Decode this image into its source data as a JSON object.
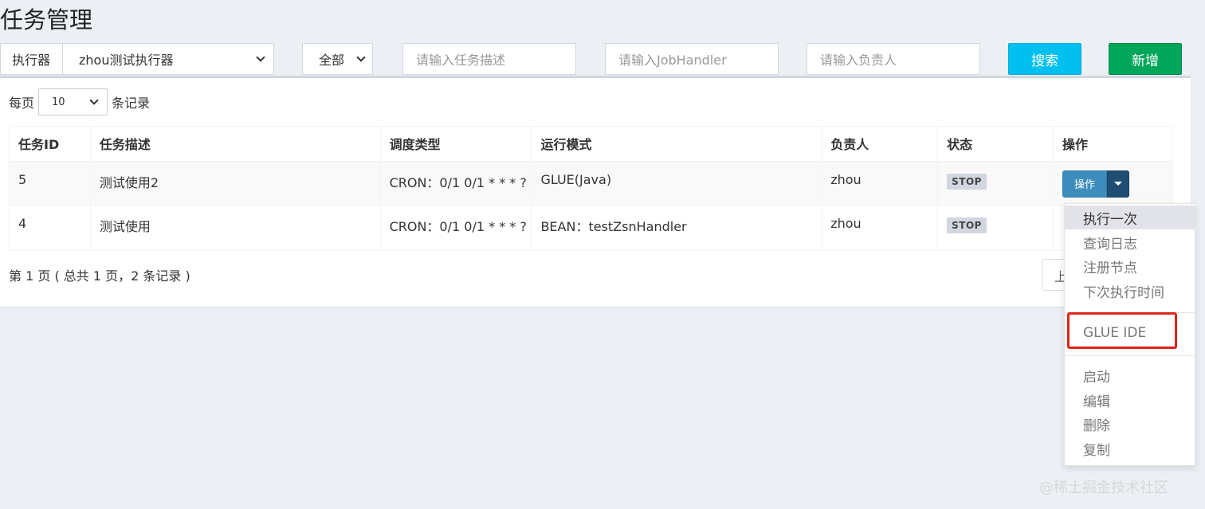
{
  "page": {
    "title": "任务管理"
  },
  "filters": {
    "executor_label": "执行器",
    "executor_value": "zhou测试执行器",
    "status_value": "全部",
    "desc_placeholder": "请输入任务描述",
    "handler_placeholder": "请输入JobHandler",
    "author_placeholder": "请输入负责人",
    "search_label": "搜索",
    "add_label": "新增"
  },
  "pagesize": {
    "prefix": "每页",
    "value": "10",
    "suffix": "条记录"
  },
  "table": {
    "columns": [
      "任务ID",
      "任务描述",
      "调度类型",
      "运行模式",
      "负责人",
      "状态",
      "操作"
    ],
    "rows": [
      {
        "id": "5",
        "desc": "测试使用2",
        "schedule": "CRON：0/1 0/1 * * * ?",
        "mode": "GLUE(Java)",
        "author": "zhou",
        "status": "STOP",
        "action": "操作"
      },
      {
        "id": "4",
        "desc": "测试使用",
        "schedule": "CRON：0/1 0/1 * * * ?",
        "mode": "BEAN：testZsnHandler",
        "author": "zhou",
        "status": "STOP"
      }
    ]
  },
  "pagination": {
    "info": "第 1 页 ( 总共 1 页，2 条记录 )",
    "prev_label": "上"
  },
  "dropdown": {
    "items": [
      "执行一次",
      "查询日志",
      "注册节点",
      "下次执行时间",
      "GLUE IDE",
      "启动",
      "编辑",
      "删除",
      "复制"
    ]
  },
  "watermark": "@稀土掘金技术社区",
  "colors": {
    "search": "#00c0ef",
    "add": "#00a65a",
    "op": "#3c8dbc",
    "highlight": "#e0241c"
  }
}
